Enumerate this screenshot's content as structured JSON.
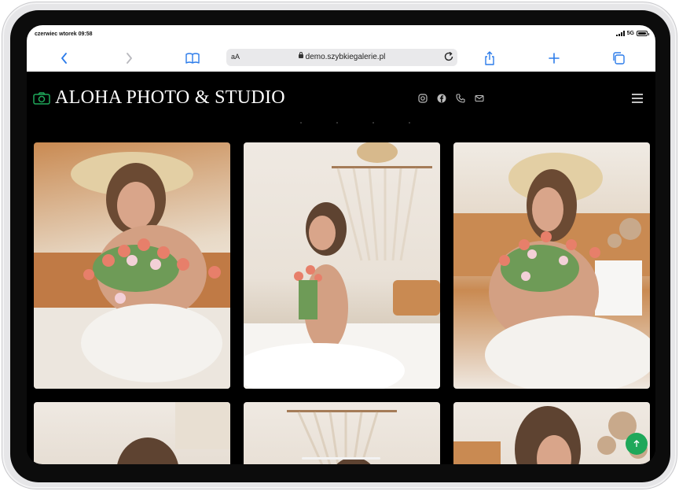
{
  "status_bar": {
    "time": "czerwiec wtorek 09:58",
    "network": "5G"
  },
  "browser": {
    "aa_label": "aA",
    "url": "demo.szybkiegalerie.pl"
  },
  "site": {
    "brand": "ALOHA PHOTO & STUDIO",
    "social_icons": [
      "instagram-icon",
      "facebook-icon",
      "phone-icon",
      "mail-icon"
    ],
    "accent_color": "#1fa85a"
  },
  "gallery": {
    "photos": [
      {
        "alt": "Woman in straw hat holding tulips"
      },
      {
        "alt": "Smiling woman with tulips under macrame"
      },
      {
        "alt": "Woman in hat with tulips seated"
      },
      {
        "alt": "Woman near window light"
      },
      {
        "alt": "Macrame wall hanging"
      },
      {
        "alt": "Woman with dried flowers"
      }
    ]
  }
}
